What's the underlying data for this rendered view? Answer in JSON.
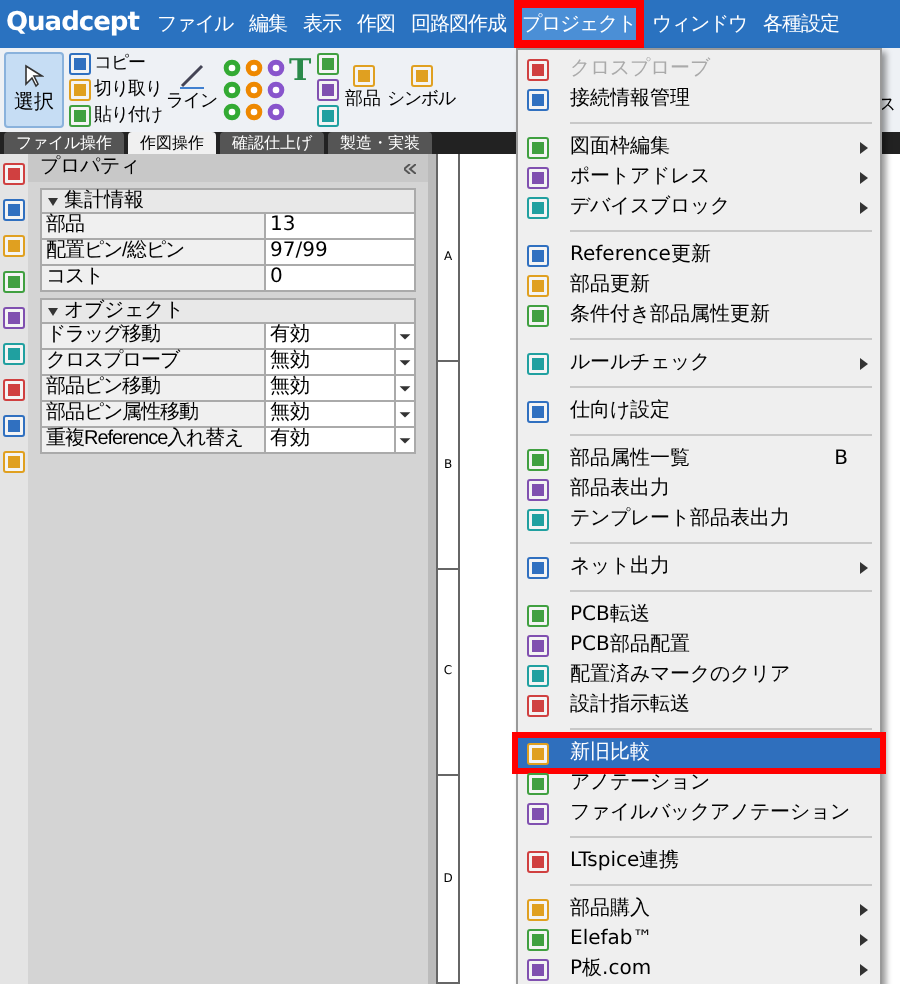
{
  "menubar": {
    "logo": "Quadcept",
    "items": [
      {
        "label": "ファイル",
        "selected": false,
        "highlighted": false
      },
      {
        "label": "編集",
        "selected": false,
        "highlighted": false
      },
      {
        "label": "表示",
        "selected": false,
        "highlighted": false
      },
      {
        "label": "作図",
        "selected": false,
        "highlighted": false
      },
      {
        "label": "回路図作成",
        "selected": false,
        "highlighted": false
      },
      {
        "label": "プロジェクト",
        "selected": true,
        "highlighted": true
      },
      {
        "label": "ウィンドウ",
        "selected": false,
        "highlighted": false
      },
      {
        "label": "各種設定",
        "selected": false,
        "highlighted": false
      }
    ]
  },
  "ribbon": {
    "select_button": {
      "label": "選択",
      "selected": true
    },
    "clipboard": [
      "コピー",
      "切り取り",
      "貼り付け"
    ],
    "line_button": "ライン",
    "text_tool": "T",
    "parts_button": "部品",
    "symbol_button": "シンボル",
    "path_button": "ス"
  },
  "tabs": [
    {
      "label": "ファイル操作",
      "selected": false
    },
    {
      "label": "作図操作",
      "selected": true
    },
    {
      "label": "確認仕上げ",
      "selected": false
    },
    {
      "label": "製造・実装",
      "selected": false
    }
  ],
  "properties": {
    "title": "プロパティ",
    "sections": [
      {
        "title": "集計情報",
        "rows": [
          {
            "label": "部品",
            "value": "13",
            "kind": "text"
          },
          {
            "label": "配置ピン/総ピン",
            "value": "97/99",
            "kind": "text"
          },
          {
            "label": "コスト",
            "value": "0",
            "kind": "text"
          }
        ]
      },
      {
        "title": "オブジェクト",
        "rows": [
          {
            "label": "ドラッグ移動",
            "value": "有効",
            "kind": "dropdown"
          },
          {
            "label": "クロスプローブ",
            "value": "無効",
            "kind": "dropdown"
          },
          {
            "label": "部品ピン移動",
            "value": "無効",
            "kind": "dropdown"
          },
          {
            "label": "部品ピン属性移動",
            "value": "無効",
            "kind": "dropdown"
          },
          {
            "label": "重複Reference入れ替え",
            "value": "有効",
            "kind": "dropdown"
          }
        ]
      }
    ]
  },
  "ruler": [
    "A",
    "B",
    "C",
    "D"
  ],
  "menu": [
    {
      "kind": "item",
      "label": "クロスプローブ",
      "disabled": true,
      "selected": false,
      "submenu": false,
      "highlighted": false
    },
    {
      "kind": "item",
      "label": "接続情報管理",
      "disabled": false,
      "selected": false,
      "submenu": false,
      "highlighted": false
    },
    {
      "kind": "separator"
    },
    {
      "kind": "item",
      "label": "図面枠編集",
      "disabled": false,
      "selected": false,
      "submenu": true,
      "highlighted": false
    },
    {
      "kind": "item",
      "label": "ポートアドレス",
      "disabled": false,
      "selected": false,
      "submenu": true,
      "highlighted": false
    },
    {
      "kind": "item",
      "label": "デバイスブロック",
      "disabled": false,
      "selected": false,
      "submenu": true,
      "highlighted": false
    },
    {
      "kind": "separator"
    },
    {
      "kind": "item",
      "label": "Reference更新",
      "disabled": false,
      "selected": false,
      "submenu": false,
      "highlighted": false
    },
    {
      "kind": "item",
      "label": "部品更新",
      "disabled": false,
      "selected": false,
      "submenu": false,
      "highlighted": false
    },
    {
      "kind": "item",
      "label": "条件付き部品属性更新",
      "disabled": false,
      "selected": false,
      "submenu": false,
      "highlighted": false
    },
    {
      "kind": "separator"
    },
    {
      "kind": "item",
      "label": "ルールチェック",
      "disabled": false,
      "selected": false,
      "submenu": true,
      "highlighted": false
    },
    {
      "kind": "separator"
    },
    {
      "kind": "item",
      "label": "仕向け設定",
      "disabled": false,
      "selected": false,
      "submenu": false,
      "highlighted": false
    },
    {
      "kind": "separator"
    },
    {
      "kind": "item",
      "label": "部品属性一覧",
      "shortcut": "B",
      "disabled": false,
      "selected": false,
      "submenu": false,
      "highlighted": false
    },
    {
      "kind": "item",
      "label": "部品表出力",
      "disabled": false,
      "selected": false,
      "submenu": false,
      "highlighted": false
    },
    {
      "kind": "item",
      "label": "テンプレート部品表出力",
      "disabled": false,
      "selected": false,
      "submenu": false,
      "highlighted": false
    },
    {
      "kind": "separator"
    },
    {
      "kind": "item",
      "label": "ネット出力",
      "disabled": false,
      "selected": false,
      "submenu": true,
      "highlighted": false
    },
    {
      "kind": "separator"
    },
    {
      "kind": "item",
      "label": "PCB転送",
      "disabled": false,
      "selected": false,
      "submenu": false,
      "highlighted": false
    },
    {
      "kind": "item",
      "label": "PCB部品配置",
      "disabled": false,
      "selected": false,
      "submenu": false,
      "highlighted": false
    },
    {
      "kind": "item",
      "label": "配置済みマークのクリア",
      "disabled": false,
      "selected": false,
      "submenu": false,
      "highlighted": false
    },
    {
      "kind": "item",
      "label": "設計指示転送",
      "disabled": false,
      "selected": false,
      "submenu": false,
      "highlighted": false
    },
    {
      "kind": "separator"
    },
    {
      "kind": "item",
      "label": "新旧比較",
      "disabled": false,
      "selected": true,
      "submenu": false,
      "highlighted": true
    },
    {
      "kind": "item",
      "label": "アノテーション",
      "disabled": false,
      "selected": false,
      "submenu": false,
      "highlighted": false
    },
    {
      "kind": "item",
      "label": "ファイルバックアノテーション",
      "disabled": false,
      "selected": false,
      "submenu": false,
      "highlighted": false
    },
    {
      "kind": "separator"
    },
    {
      "kind": "item",
      "label": "LTspice連携",
      "disabled": false,
      "selected": false,
      "submenu": false,
      "highlighted": false
    },
    {
      "kind": "separator"
    },
    {
      "kind": "item",
      "label": "部品購入",
      "disabled": false,
      "selected": false,
      "submenu": true,
      "highlighted": false
    },
    {
      "kind": "item",
      "label": "Elefab™",
      "disabled": false,
      "selected": false,
      "submenu": true,
      "highlighted": false
    },
    {
      "kind": "item",
      "label": "P板.com",
      "disabled": false,
      "selected": false,
      "submenu": true,
      "highlighted": false
    }
  ]
}
